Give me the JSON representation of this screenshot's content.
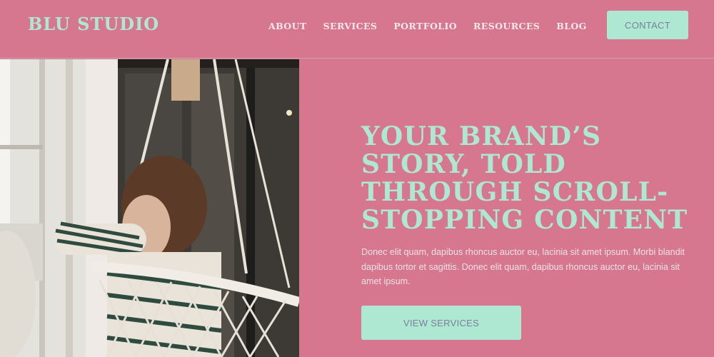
{
  "brand": {
    "name": "BLU STUDIO"
  },
  "nav": {
    "items": [
      {
        "label": "ABOUT"
      },
      {
        "label": "SERVICES"
      },
      {
        "label": "PORTFOLIO"
      },
      {
        "label": "RESOURCES"
      },
      {
        "label": "BLOG"
      }
    ],
    "contact_label": "CONTACT"
  },
  "hero": {
    "headline": "YOUR BRAND’S STORY, TOLD THROUGH SCROLL-STOPPING CONTENT",
    "body": "Donec elit quam, dapibus rhoncus auctor eu, lacinia sit amet ipsum. Morbi blandit dapibus tortor et sagittis. Donec elit quam, dapibus rhoncus auctor eu, lacinia sit amet ipsum.",
    "cta_label": "VIEW SERVICES"
  },
  "colors": {
    "background": "#d6778f",
    "accent": "#aee8d2",
    "button_text": "#7a7f9a"
  }
}
